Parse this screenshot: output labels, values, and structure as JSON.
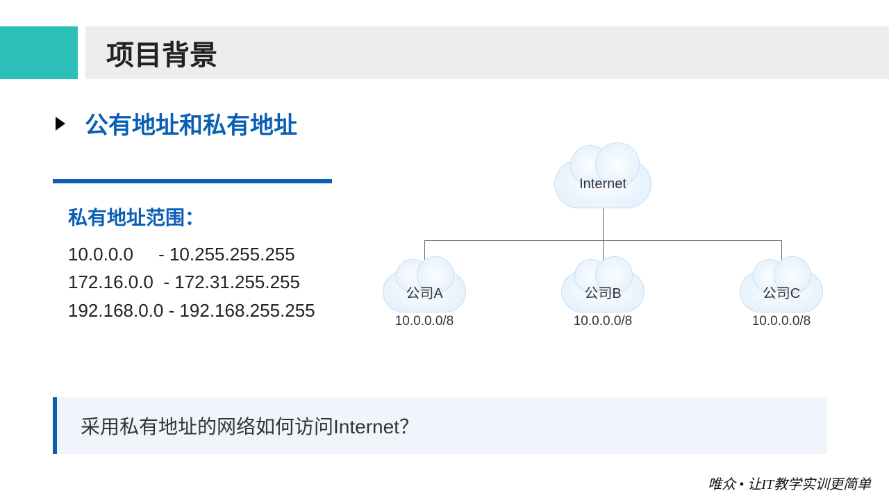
{
  "header": {
    "title": "项目背景"
  },
  "section": {
    "heading": "公有地址和私有地址"
  },
  "panel": {
    "heading": "私有地址范围：",
    "ranges": [
      "10.0.0.0     - 10.255.255.255",
      "172.16.0.0  - 172.31.255.255",
      "192.168.0.0 - 192.168.255.255"
    ]
  },
  "diagram": {
    "root": "Internet",
    "nodes": [
      {
        "label": "公司A",
        "subnet": "10.0.0.0/8"
      },
      {
        "label": "公司B",
        "subnet": "10.0.0.0/8"
      },
      {
        "label": "公司C",
        "subnet": "10.0.0.0/8"
      }
    ]
  },
  "question": "采用私有地址的网络如何访问Internet？",
  "footer": "唯众 • 让IT教学实训更简单"
}
